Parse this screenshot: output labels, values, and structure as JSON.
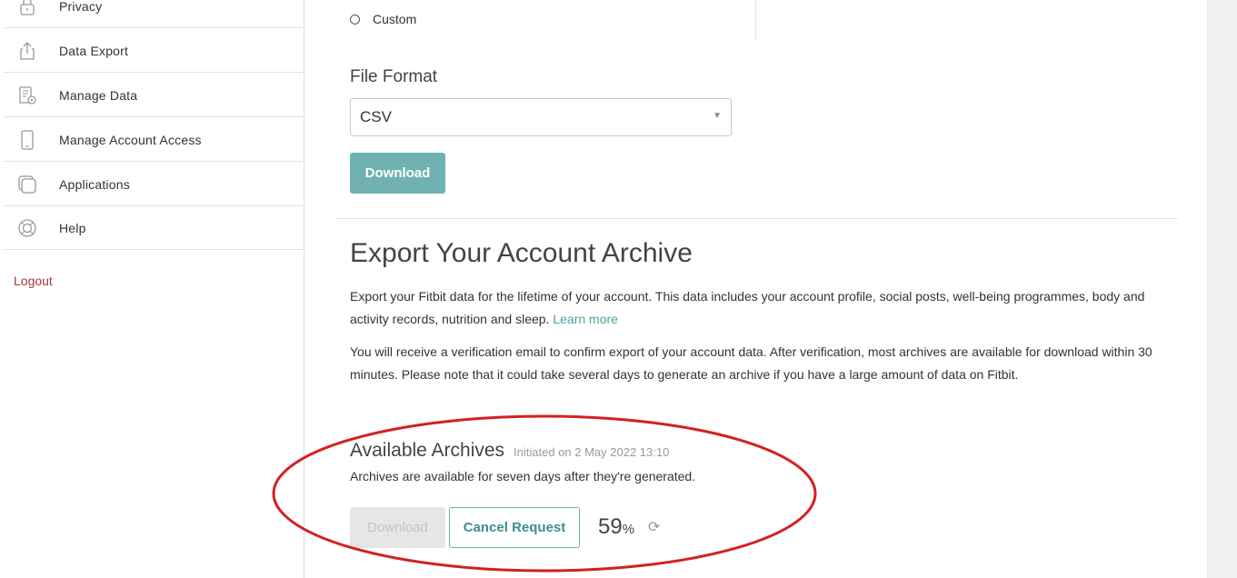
{
  "sidebar": {
    "items": [
      {
        "label": "Privacy",
        "icon": "lock-icon"
      },
      {
        "label": "Data Export",
        "icon": "export-icon"
      },
      {
        "label": "Manage Data",
        "icon": "manage-data-icon"
      },
      {
        "label": "Manage Account Access",
        "icon": "phone-icon"
      },
      {
        "label": "Applications",
        "icon": "applications-icon"
      },
      {
        "label": "Help",
        "icon": "lifebuoy-icon"
      }
    ],
    "logout_label": "Logout"
  },
  "export_range": {
    "custom_option_label": "Custom"
  },
  "file_format": {
    "label": "File Format",
    "selected": "CSV",
    "download_label": "Download"
  },
  "archive": {
    "title": "Export Your Account Archive",
    "description": "Export your Fitbit data for the lifetime of your account. This data includes your account profile, social posts, well-being programmes, body and activity records, nutrition and sleep.",
    "learn_more_label": "Learn more",
    "verification_text": "You will receive a verification email to confirm export of your account data. After verification, most archives are available for download within 30 minutes. Please note that it could take several days to generate an archive if you have a large amount of data on Fitbit."
  },
  "available_archives": {
    "title": "Available Archives",
    "initiated": "Initiated on 2 May 2022 13:10",
    "note": "Archives are available for seven days after they're generated.",
    "download_label": "Download",
    "cancel_label": "Cancel Request",
    "progress_value": "59",
    "progress_unit": "%"
  },
  "colors": {
    "accent": "#6fb2b1",
    "link": "#4aa3a1",
    "logout": "#a03a3a",
    "annotation": "#d42020"
  }
}
